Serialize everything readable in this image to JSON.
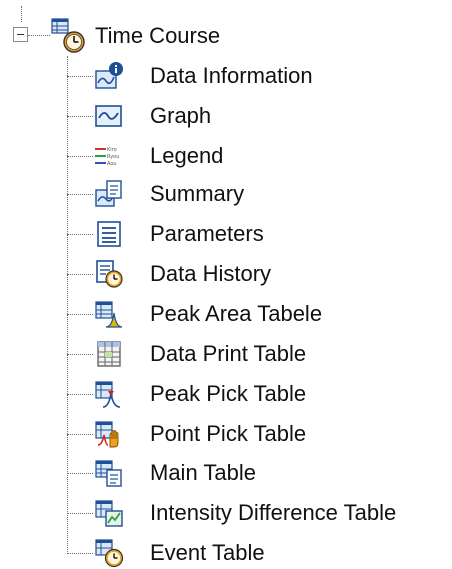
{
  "tree": {
    "root": {
      "label": "Time Course",
      "icon": "time-course-icon",
      "expanded": true
    },
    "items": [
      {
        "label": "Data Information",
        "icon": "data-information-icon"
      },
      {
        "label": "Graph",
        "icon": "graph-icon"
      },
      {
        "label": "Legend",
        "icon": "legend-icon",
        "icon_text": [
          "Kiro",
          "Ryou",
          "Aou"
        ]
      },
      {
        "label": "Summary",
        "icon": "summary-icon"
      },
      {
        "label": "Parameters",
        "icon": "parameters-icon"
      },
      {
        "label": "Data History",
        "icon": "data-history-icon"
      },
      {
        "label": "Peak Area Tabele",
        "icon": "peak-area-table-icon"
      },
      {
        "label": "Data Print Table",
        "icon": "data-print-table-icon"
      },
      {
        "label": "Peak Pick Table",
        "icon": "peak-pick-table-icon"
      },
      {
        "label": "Point Pick Table",
        "icon": "point-pick-table-icon"
      },
      {
        "label": "Main Table",
        "icon": "main-table-icon"
      },
      {
        "label": "Intensity Difference Table",
        "icon": "intensity-difference-table-icon"
      },
      {
        "label": "Event Table",
        "icon": "event-table-icon"
      }
    ]
  },
  "colors": {
    "icon_blue": "#1f4f96",
    "icon_light_blue": "#dbe8f8",
    "clock_orange": "#f0a020",
    "peak_yellow": "#e8b800",
    "peak_red": "#d02020",
    "legend_red": "#d03030",
    "legend_green": "#30a040",
    "legend_blue": "#3050c0"
  }
}
